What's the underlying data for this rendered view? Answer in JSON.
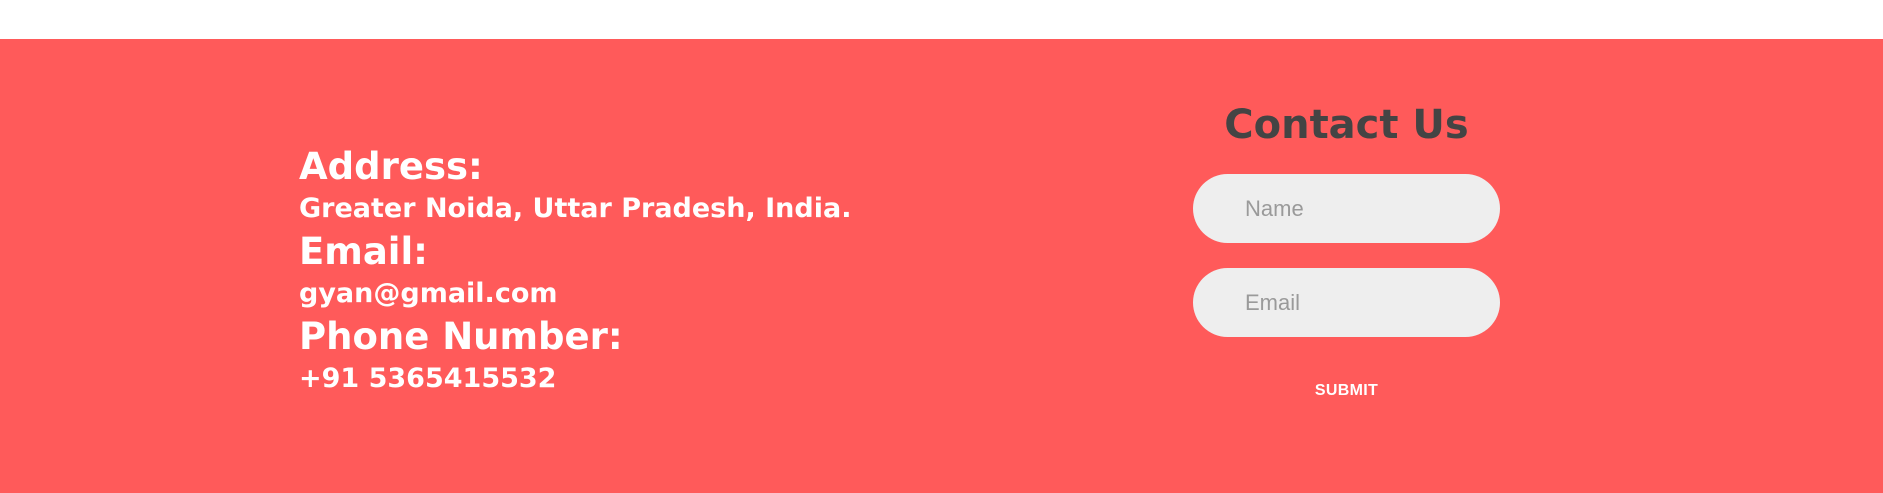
{
  "contact_info": {
    "address_label": "Address:",
    "address_value": "Greater Noida, Uttar Pradesh, India.",
    "email_label": "Email:",
    "email_value": "gyan@gmail.com",
    "phone_label": "Phone Number:",
    "phone_value": "+91 5365415532"
  },
  "contact_form": {
    "title": "Contact Us",
    "name_placeholder": "Name",
    "email_placeholder": "Email",
    "submit_label": "SUBMIT"
  },
  "colors": {
    "background": "#ff5a5a",
    "heading": "#444444",
    "text": "#ffffff",
    "input_bg": "#eeeeee"
  }
}
